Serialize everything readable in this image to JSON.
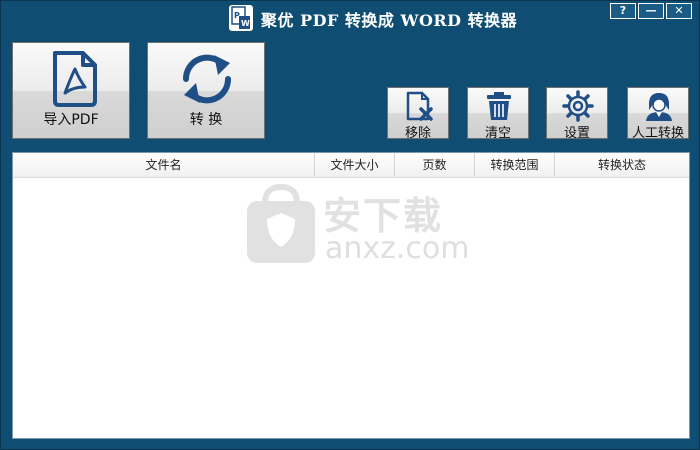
{
  "window": {
    "title": "聚优 PDF 转换成 WORD 转换器",
    "controls": {
      "help": "?",
      "minimize": "—",
      "close": "✕"
    }
  },
  "toolbar": {
    "import_label": "导入PDF",
    "convert_label": "转 换",
    "remove_label": "移除",
    "clear_label": "清空",
    "settings_label": "设置",
    "manual_label": "人工转换"
  },
  "table": {
    "columns": [
      "文件名",
      "文件大小",
      "页数",
      "转换范围",
      "转换状态"
    ],
    "rows": []
  },
  "watermark": {
    "text_cn": "安下载",
    "text_en": "anxz.com"
  },
  "colors": {
    "window_bg": "#0f4d72",
    "icon_blue": "#1f4f86",
    "watermark": "#dedede"
  }
}
